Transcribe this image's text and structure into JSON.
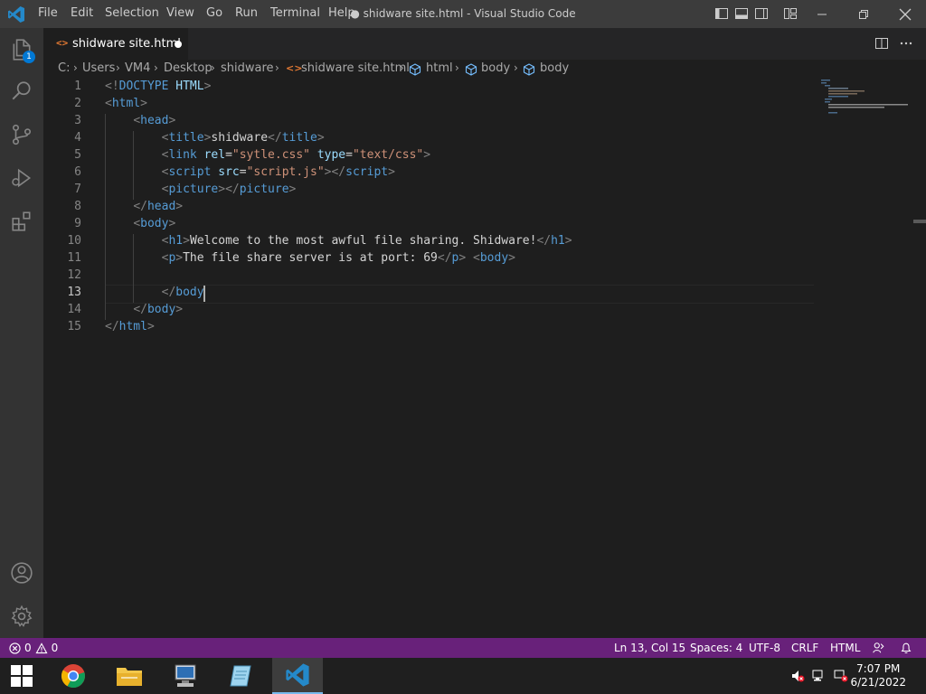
{
  "titlebar": {
    "menu": [
      "File",
      "Edit",
      "Selection",
      "View",
      "Go",
      "Run",
      "Terminal",
      "Help"
    ],
    "window_title": "● shidware site.html - Visual Studio Code"
  },
  "activity": {
    "explorer_badge": "1"
  },
  "tab": {
    "label": "shidware site.html",
    "icon": "<>"
  },
  "breadcrumb": [
    "C:",
    "Users",
    "VM4",
    "Desktop",
    "shidware",
    "shidware site.html",
    "html",
    "body",
    "body"
  ],
  "editor": {
    "line_numbers": [
      "1",
      "2",
      "3",
      "4",
      "5",
      "6",
      "7",
      "8",
      "9",
      "10",
      "11",
      "12",
      "13",
      "14",
      "15"
    ],
    "active_line": 13,
    "lines": [
      [
        [
          "t",
          "<!"
        ],
        [
          "tag",
          "DOCTYPE"
        ],
        [
          "attr",
          " HTML"
        ],
        [
          "t",
          ">"
        ]
      ],
      [
        [
          "t",
          "<"
        ],
        [
          "tag",
          "html"
        ],
        [
          "t",
          ">"
        ]
      ],
      [
        [
          "txt",
          "    "
        ],
        [
          "t",
          "<"
        ],
        [
          "tag",
          "head"
        ],
        [
          "t",
          ">"
        ]
      ],
      [
        [
          "txt",
          "        "
        ],
        [
          "t",
          "<"
        ],
        [
          "tag",
          "title"
        ],
        [
          "t",
          ">"
        ],
        [
          "txt",
          "shidware"
        ],
        [
          "t",
          "</"
        ],
        [
          "tag",
          "title"
        ],
        [
          "t",
          ">"
        ]
      ],
      [
        [
          "txt",
          "        "
        ],
        [
          "t",
          "<"
        ],
        [
          "tag",
          "link"
        ],
        [
          "txt",
          " "
        ],
        [
          "attr",
          "rel"
        ],
        [
          "txt",
          "="
        ],
        [
          "str",
          "\"sytle.css\""
        ],
        [
          "txt",
          " "
        ],
        [
          "attr",
          "type"
        ],
        [
          "txt",
          "="
        ],
        [
          "str",
          "\"text/css\""
        ],
        [
          "t",
          ">"
        ]
      ],
      [
        [
          "txt",
          "        "
        ],
        [
          "t",
          "<"
        ],
        [
          "tag",
          "script"
        ],
        [
          "txt",
          " "
        ],
        [
          "attr",
          "src"
        ],
        [
          "txt",
          "="
        ],
        [
          "str",
          "\"script.js\""
        ],
        [
          "t",
          "></"
        ],
        [
          "tag",
          "script"
        ],
        [
          "t",
          ">"
        ]
      ],
      [
        [
          "txt",
          "        "
        ],
        [
          "t",
          "<"
        ],
        [
          "tag",
          "picture"
        ],
        [
          "t",
          "></"
        ],
        [
          "tag",
          "picture"
        ],
        [
          "t",
          ">"
        ]
      ],
      [
        [
          "txt",
          "    "
        ],
        [
          "t",
          "</"
        ],
        [
          "tag",
          "head"
        ],
        [
          "t",
          ">"
        ]
      ],
      [
        [
          "txt",
          "    "
        ],
        [
          "t",
          "<"
        ],
        [
          "tag",
          "body"
        ],
        [
          "t",
          ">"
        ]
      ],
      [
        [
          "txt",
          "        "
        ],
        [
          "t",
          "<"
        ],
        [
          "tag",
          "h1"
        ],
        [
          "t",
          ">"
        ],
        [
          "txt",
          "Welcome to the most awful file sharing. Shidware!"
        ],
        [
          "t",
          "</"
        ],
        [
          "tag",
          "h1"
        ],
        [
          "t",
          ">"
        ]
      ],
      [
        [
          "txt",
          "        "
        ],
        [
          "t",
          "<"
        ],
        [
          "tag",
          "p"
        ],
        [
          "t",
          ">"
        ],
        [
          "txt",
          "The file share server is at port: 69"
        ],
        [
          "t",
          "</"
        ],
        [
          "tag",
          "p"
        ],
        [
          "t",
          ">"
        ],
        [
          "txt",
          " "
        ],
        [
          "t",
          "<"
        ],
        [
          "tag",
          "body"
        ],
        [
          "t",
          ">"
        ]
      ],
      [
        [
          "txt",
          ""
        ]
      ],
      [
        [
          "txt",
          "        "
        ],
        [
          "t",
          "</"
        ],
        [
          "tag",
          "body"
        ]
      ],
      [
        [
          "txt",
          "    "
        ],
        [
          "t",
          "</"
        ],
        [
          "tag",
          "body"
        ],
        [
          "t",
          ">"
        ]
      ],
      [
        [
          "t",
          "</"
        ],
        [
          "tag",
          "html"
        ],
        [
          "t",
          ">"
        ]
      ]
    ]
  },
  "statusbar": {
    "errors": "0",
    "warnings": "0",
    "position": "Ln 13, Col 15",
    "spaces": "Spaces: 4",
    "encoding": "UTF-8",
    "eol": "CRLF",
    "language": "HTML"
  },
  "taskbar": {
    "time": "7:07 PM",
    "date": "6/21/2022"
  },
  "colors": {
    "statusbar": "#68217a",
    "accent": "#0078d4",
    "tag": "#569cd6",
    "attr": "#9cdcfe",
    "string": "#ce9178"
  }
}
